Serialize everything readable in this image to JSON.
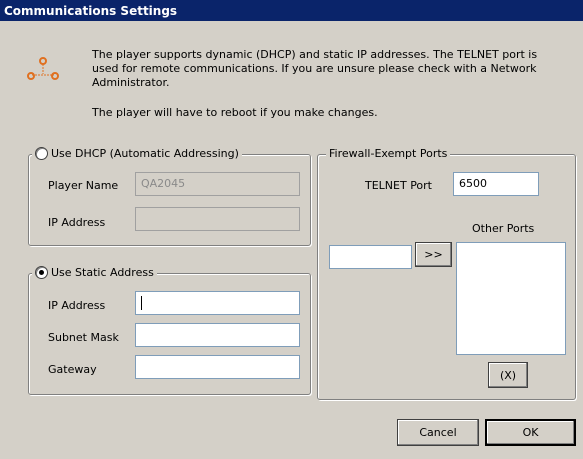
{
  "window": {
    "title": "Communications Settings"
  },
  "info": {
    "line1": "The player supports dynamic (DHCP) and static IP addresses.  The TELNET port is",
    "line2": "used for remote communications.  If you are unsure please check with a Network",
    "line3": "Administrator.",
    "reboot_note": "The player will have to reboot if you make changes.",
    "icon": "network-icon"
  },
  "dhcp": {
    "label": "Use DHCP (Automatic Addressing)",
    "selected": false,
    "player_name_label": "Player Name",
    "player_name_value": "QA2045",
    "ip_label": "IP Address",
    "ip_value": ""
  },
  "static": {
    "label": "Use Static Address",
    "selected": true,
    "ip_label": "IP Address",
    "ip_value": "",
    "subnet_label": "Subnet Mask",
    "subnet_value": "",
    "gateway_label": "Gateway",
    "gateway_value": ""
  },
  "firewall": {
    "title": "Firewall-Exempt Ports",
    "telnet_label": "TELNET Port",
    "telnet_value": "6500",
    "other_ports_label": "Other Ports",
    "port_input_value": "",
    "add_button": ">>",
    "remove_button": "(X)"
  },
  "footer": {
    "cancel": "Cancel",
    "ok": "OK"
  }
}
